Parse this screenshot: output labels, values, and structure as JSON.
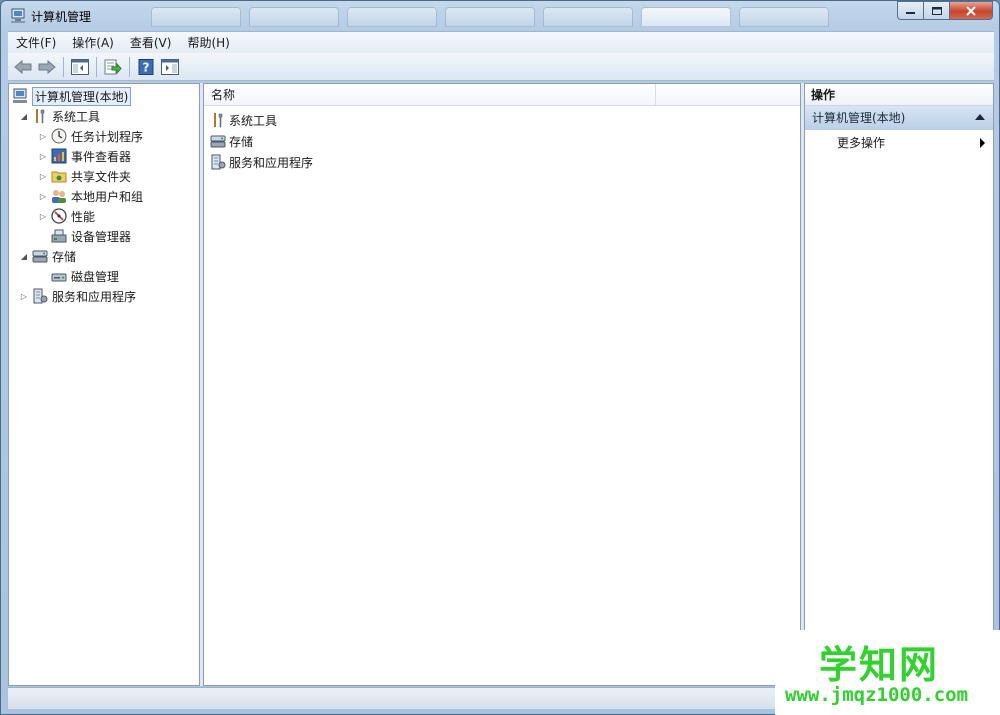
{
  "window": {
    "title": "计算机管理"
  },
  "menu": [
    "文件(F)",
    "操作(A)",
    "查看(V)",
    "帮助(H)"
  ],
  "tree": {
    "root": "计算机管理(本地)",
    "system_tools": "系统工具",
    "task_scheduler": "任务计划程序",
    "event_viewer": "事件查看器",
    "shared_folders": "共享文件夹",
    "local_users": "本地用户和组",
    "performance": "性能",
    "device_manager": "设备管理器",
    "storage": "存储",
    "disk_management": "磁盘管理",
    "services_apps": "服务和应用程序"
  },
  "list": {
    "column_name": "名称",
    "items": [
      "系统工具",
      "存储",
      "服务和应用程序"
    ]
  },
  "actions": {
    "header": "操作",
    "section": "计算机管理(本地)",
    "more": "更多操作"
  },
  "watermark": {
    "big": "学知网",
    "small": "www.jmqz1000.com"
  }
}
